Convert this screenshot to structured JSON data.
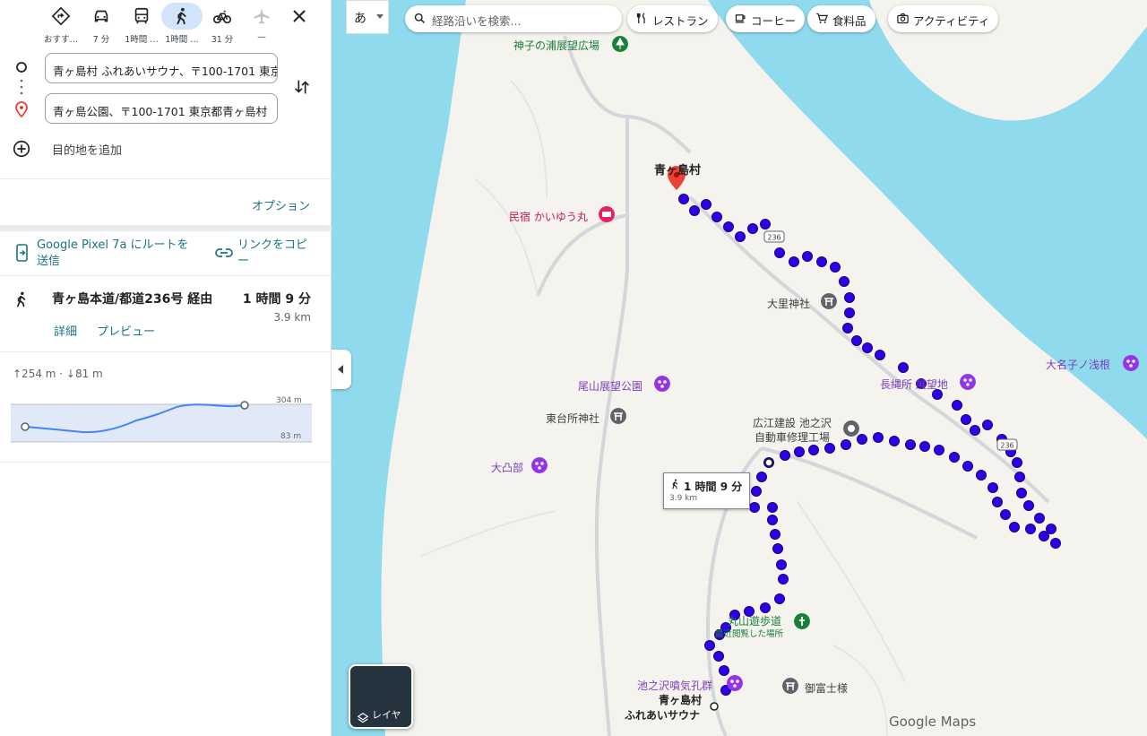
{
  "modes": [
    {
      "name": "best",
      "label": "おすす…"
    },
    {
      "name": "car",
      "label": "7 分"
    },
    {
      "name": "transit",
      "label": "1時間 …"
    },
    {
      "name": "walk",
      "label": "1時間 …"
    },
    {
      "name": "bike",
      "label": "31 分"
    },
    {
      "name": "flight",
      "label": "—"
    }
  ],
  "start": {
    "value": "青ヶ島村 ふれあいサウナ、〒100-1701 東京"
  },
  "end": {
    "value": "青ヶ島公園、〒100-1701 東京都青ヶ島村"
  },
  "add_destination": "目的地を追加",
  "options_label": "オプション",
  "send_to_phone": "Google Pixel 7a にルートを送信",
  "copy_link": "リンクをコピー",
  "route": {
    "title": "青ヶ島本道/都道236号 経由",
    "time": "1 時間 9 分",
    "distance": "3.9 km",
    "details": "詳細",
    "preview": "プレビュー"
  },
  "elevation": {
    "summary": "↑254 m · ↓81 m",
    "max": "304 m",
    "min": "83 m"
  },
  "map": {
    "lang": "あ",
    "search_placeholder": "経路沿いを検索...",
    "chips": [
      "レストラン",
      "コーヒー",
      "食料品",
      "アクティビティ"
    ],
    "layers_label": "レイヤ",
    "logo": "Google Maps",
    "tooltip_time": "1 時間 9 分",
    "tooltip_dist": "3.9 km",
    "road_label": "236",
    "pois": {
      "kamiko": "神子の浦展望広場",
      "village": "青ヶ島村",
      "minshuku": "民宿 かいゆう丸",
      "osato": "大里神社",
      "onagoshi": "大名子ノ浅根",
      "nagunawa": "長縄所 展望地",
      "oyama": "尾山展望公園",
      "higashidai": "東台所神社",
      "hiroe1": "広江建設 池之沢",
      "hiroe2": "自動車修理工場",
      "otobe": "大凸部",
      "maruyama": "丸山遊歩道",
      "recent": "最近閲覧した場所",
      "ikenosawa": "池之沢噴気孔群",
      "ofuji": "御富士様",
      "sauna1": "青ヶ島村",
      "sauna2": "ふれあいサウナ"
    }
  },
  "colors": {
    "accent": "#1a7381",
    "route": "#2e00e6",
    "water": "#90daee",
    "land": "#f5f3ee"
  }
}
